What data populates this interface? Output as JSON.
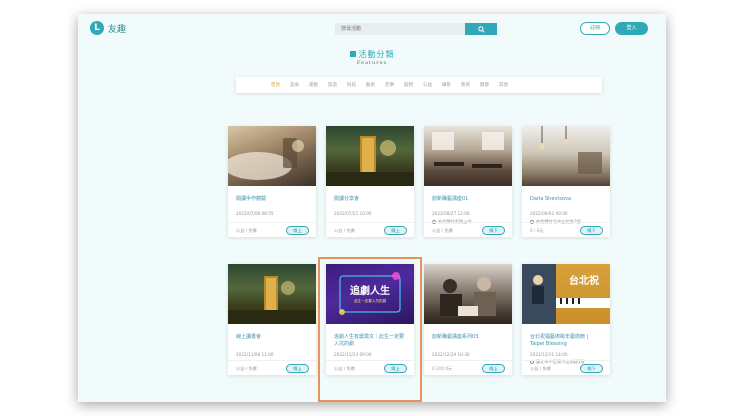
{
  "header": {
    "logo_mark": "L",
    "logo_text": "友趣",
    "search_placeholder": "搜尋活動",
    "register_label": "註冊",
    "login_label": "登入"
  },
  "section": {
    "title": "活動分類",
    "subtitle": "Features"
  },
  "categories": [
    {
      "label": "首頁",
      "active": true
    },
    {
      "label": "美食"
    },
    {
      "label": "運動"
    },
    {
      "label": "旅遊"
    },
    {
      "label": "科技"
    },
    {
      "label": "藝術"
    },
    {
      "label": "音樂"
    },
    {
      "label": "寵物"
    },
    {
      "label": "公益"
    },
    {
      "label": "攝影"
    },
    {
      "label": "教育"
    },
    {
      "label": "健康"
    },
    {
      "label": "其他"
    }
  ],
  "cards": [
    {
      "title": "閱讀手作體驗",
      "date": "2022/07/08 08:55",
      "location": "",
      "price": "公益 / 免費",
      "button": "線上"
    },
    {
      "title": "閱讀分享會",
      "date": "2022/07/22 10:00",
      "location": "",
      "price": "公益 / 免費",
      "button": "線上"
    },
    {
      "title": "創新職藝講座01",
      "date": "2022/08/27 12:00",
      "location": "新竹縣竹東鎮上坪",
      "price": "公益 / 免費",
      "button": "線下"
    },
    {
      "title": "Daria Shevtsova",
      "date": "2022/09/02 09:00",
      "location": "新竹縣竹北市三民路1號",
      "price": "0 / 0元",
      "button": "線下"
    },
    {
      "title": "線上讀書會",
      "date": "2022/11/08 11:00",
      "location": "",
      "price": "公益 / 免費",
      "button": "線上"
    },
    {
      "title": "追劇人生有獎徵文｜此生一定要入坑的劇",
      "date": "2022/11/23 09:00",
      "location": "",
      "price": "公益 / 免費",
      "button": "線上"
    },
    {
      "title": "創新職藝講座系列03",
      "date": "2022/12/29 10:30",
      "location": "",
      "price": "0 200 0元",
      "button": "線上"
    },
    {
      "title": "台北祝福藝術跨年藝術節 | Taipei Blessing",
      "date": "2022/12/31 14:00",
      "location": "臺北市中正區中山南路1號",
      "price": "公益 / 免費",
      "button": "線下"
    }
  ],
  "images": {
    "neon_text": "追劇人生",
    "neon_sub": "此生一定要入坑的劇",
    "taipei_text": "台北祝"
  }
}
